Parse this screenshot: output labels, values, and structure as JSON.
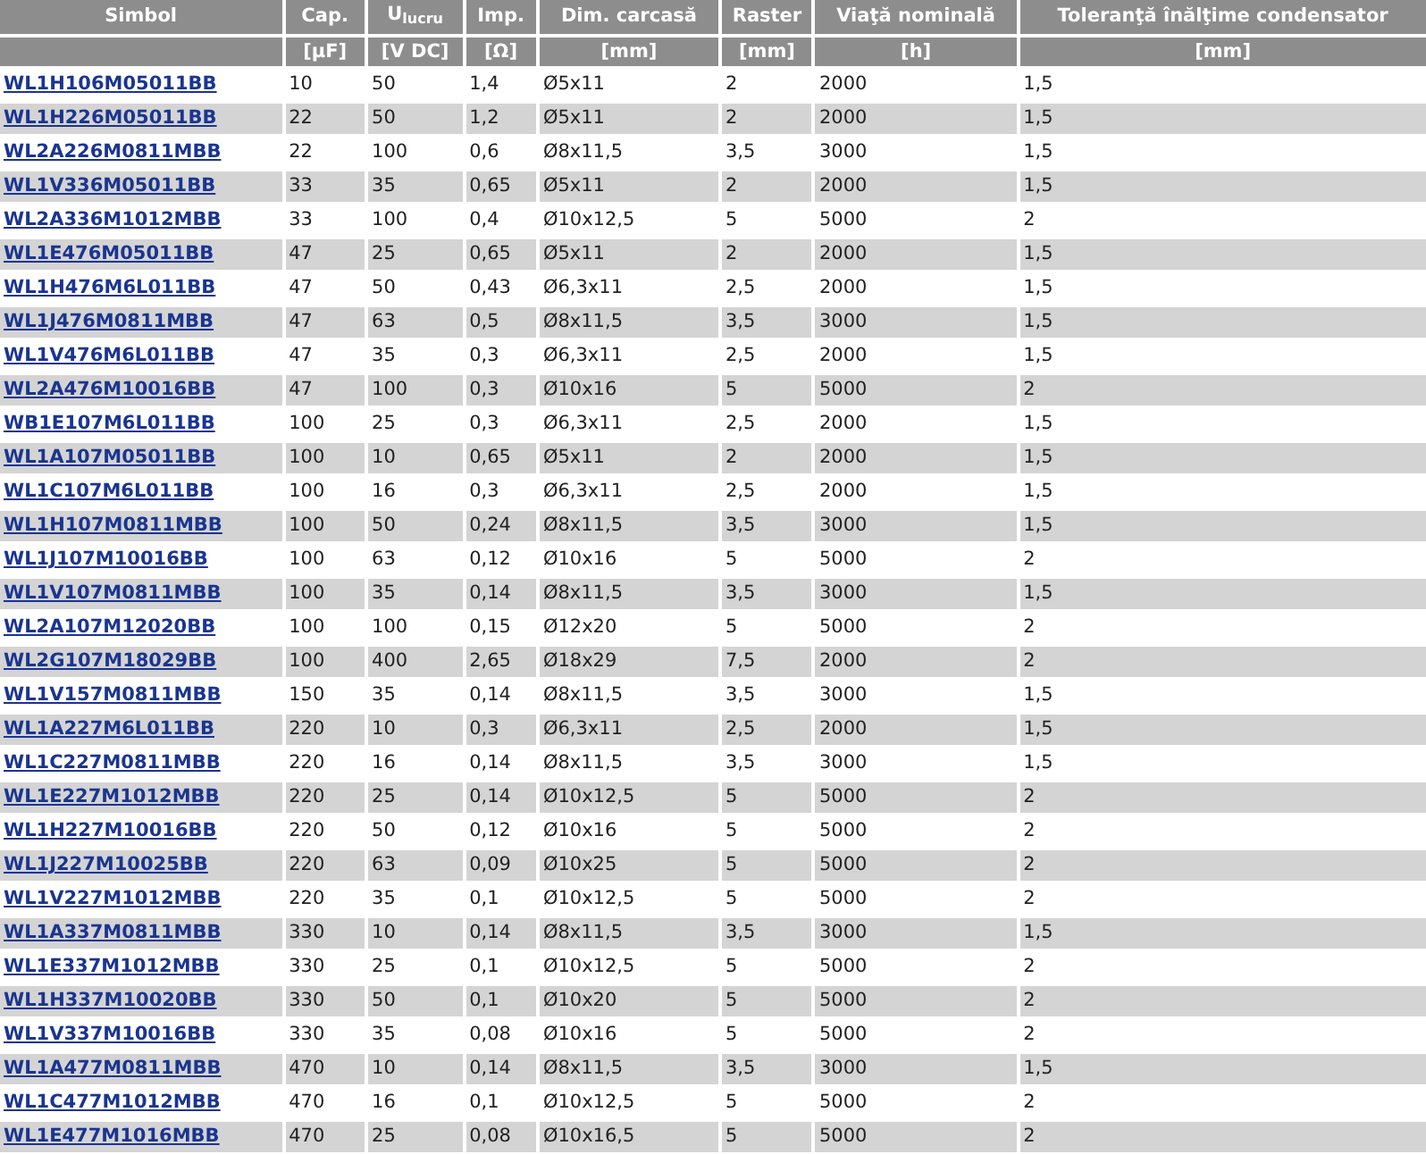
{
  "table": {
    "columns": [
      {
        "label": "Simbol"
      },
      {
        "label": "Cap.",
        "unit": "[µF]"
      },
      {
        "label": "U$_{lucru}$",
        "unit": "[V DC]"
      },
      {
        "label": "Imp.",
        "unit": "[Ω]"
      },
      {
        "label": "Dim. carcasă",
        "unit": "[mm]"
      },
      {
        "label": "Raster",
        "unit": "[mm]"
      },
      {
        "label": "Viaţă nominală",
        "unit": "[h]"
      },
      {
        "label": "Toleranţă înălţime condensator",
        "unit": "[mm]"
      }
    ],
    "rows": [
      [
        "WL1H106M05011BB",
        "10",
        "50",
        "1,4",
        "Ø5x11",
        "2",
        "2000",
        "1,5"
      ],
      [
        "WL1H226M05011BB",
        "22",
        "50",
        "1,2",
        "Ø5x11",
        "2",
        "2000",
        "1,5"
      ],
      [
        "WL2A226M0811MBB",
        "22",
        "100",
        "0,6",
        "Ø8x11,5",
        "3,5",
        "3000",
        "1,5"
      ],
      [
        "WL1V336M05011BB",
        "33",
        "35",
        "0,65",
        "Ø5x11",
        "2",
        "2000",
        "1,5"
      ],
      [
        "WL2A336M1012MBB",
        "33",
        "100",
        "0,4",
        "Ø10x12,5",
        "5",
        "5000",
        "2"
      ],
      [
        "WL1E476M05011BB",
        "47",
        "25",
        "0,65",
        "Ø5x11",
        "2",
        "2000",
        "1,5"
      ],
      [
        "WL1H476M6L011BB",
        "47",
        "50",
        "0,43",
        "Ø6,3x11",
        "2,5",
        "2000",
        "1,5"
      ],
      [
        "WL1J476M0811MBB",
        "47",
        "63",
        "0,5",
        "Ø8x11,5",
        "3,5",
        "3000",
        "1,5"
      ],
      [
        "WL1V476M6L011BB",
        "47",
        "35",
        "0,3",
        "Ø6,3x11",
        "2,5",
        "2000",
        "1,5"
      ],
      [
        "WL2A476M10016BB",
        "47",
        "100",
        "0,3",
        "Ø10x16",
        "5",
        "5000",
        "2"
      ],
      [
        "WB1E107M6L011BB",
        "100",
        "25",
        "0,3",
        "Ø6,3x11",
        "2,5",
        "2000",
        "1,5"
      ],
      [
        "WL1A107M05011BB",
        "100",
        "10",
        "0,65",
        "Ø5x11",
        "2",
        "2000",
        "1,5"
      ],
      [
        "WL1C107M6L011BB",
        "100",
        "16",
        "0,3",
        "Ø6,3x11",
        "2,5",
        "2000",
        "1,5"
      ],
      [
        "WL1H107M0811MBB",
        "100",
        "50",
        "0,24",
        "Ø8x11,5",
        "3,5",
        "3000",
        "1,5"
      ],
      [
        "WL1J107M10016BB",
        "100",
        "63",
        "0,12",
        "Ø10x16",
        "5",
        "5000",
        "2"
      ],
      [
        "WL1V107M0811MBB",
        "100",
        "35",
        "0,14",
        "Ø8x11,5",
        "3,5",
        "3000",
        "1,5"
      ],
      [
        "WL2A107M12020BB",
        "100",
        "100",
        "0,15",
        "Ø12x20",
        "5",
        "5000",
        "2"
      ],
      [
        "WL2G107M18029BB",
        "100",
        "400",
        "2,65",
        "Ø18x29",
        "7,5",
        "2000",
        "2"
      ],
      [
        "WL1V157M0811MBB",
        "150",
        "35",
        "0,14",
        "Ø8x11,5",
        "3,5",
        "3000",
        "1,5"
      ],
      [
        "WL1A227M6L011BB",
        "220",
        "10",
        "0,3",
        "Ø6,3x11",
        "2,5",
        "2000",
        "1,5"
      ],
      [
        "WL1C227M0811MBB",
        "220",
        "16",
        "0,14",
        "Ø8x11,5",
        "3,5",
        "3000",
        "1,5"
      ],
      [
        "WL1E227M1012MBB",
        "220",
        "25",
        "0,14",
        "Ø10x12,5",
        "5",
        "5000",
        "2"
      ],
      [
        "WL1H227M10016BB",
        "220",
        "50",
        "0,12",
        "Ø10x16",
        "5",
        "5000",
        "2"
      ],
      [
        "WL1J227M10025BB",
        "220",
        "63",
        "0,09",
        "Ø10x25",
        "5",
        "5000",
        "2"
      ],
      [
        "WL1V227M1012MBB",
        "220",
        "35",
        "0,1",
        "Ø10x12,5",
        "5",
        "5000",
        "2"
      ],
      [
        "WL1A337M0811MBB",
        "330",
        "10",
        "0,14",
        "Ø8x11,5",
        "3,5",
        "3000",
        "1,5"
      ],
      [
        "WL1E337M1012MBB",
        "330",
        "25",
        "0,1",
        "Ø10x12,5",
        "5",
        "5000",
        "2"
      ],
      [
        "WL1H337M10020BB",
        "330",
        "50",
        "0,1",
        "Ø10x20",
        "5",
        "5000",
        "2"
      ],
      [
        "WL1V337M10016BB",
        "330",
        "35",
        "0,08",
        "Ø10x16",
        "5",
        "5000",
        "2"
      ],
      [
        "WL1A477M0811MBB",
        "470",
        "10",
        "0,14",
        "Ø8x11,5",
        "3,5",
        "3000",
        "1,5"
      ],
      [
        "WL1C477M1012MBB",
        "470",
        "16",
        "0,1",
        "Ø10x12,5",
        "5",
        "5000",
        "2"
      ],
      [
        "WL1E477M1016MBB",
        "470",
        "25",
        "0,08",
        "Ø10x16,5",
        "5",
        "5000",
        "2"
      ]
    ]
  }
}
